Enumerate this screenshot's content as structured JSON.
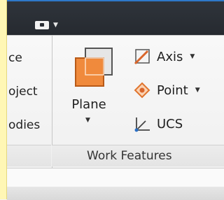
{
  "left_panel": {
    "items": [
      "ce",
      "oject",
      "odies"
    ]
  },
  "quick_access": {
    "caret": "▼"
  },
  "plane": {
    "label": "Plane",
    "caret": "▼"
  },
  "tools": [
    {
      "label": "Axis",
      "caret": "▼"
    },
    {
      "label": "Point",
      "caret": "▼"
    },
    {
      "label": "UCS"
    }
  ],
  "panel": {
    "title": "Work Features"
  },
  "colors": {
    "plane_orange": "#f08a3c",
    "titlebar": "#2a2e34",
    "accent_blue": "#2e78c9",
    "panel_yellow": "#fff7b5"
  }
}
